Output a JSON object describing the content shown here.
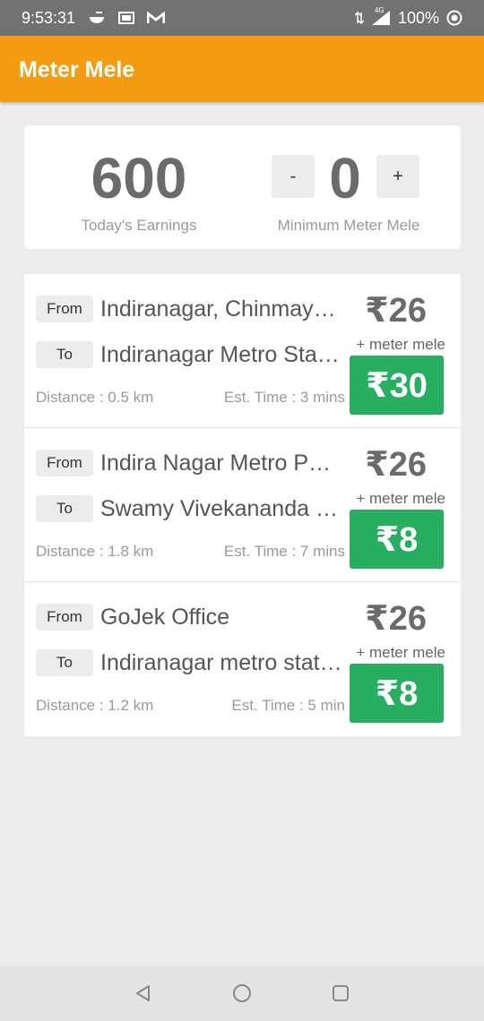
{
  "status": {
    "time": "9:53:31",
    "network": "4G",
    "battery": "100%",
    "icons": [
      "bowl-icon",
      "gsheet-icon",
      "gmail-icon",
      "data-arrows-icon",
      "signal-icon",
      "sync-icon"
    ]
  },
  "app": {
    "title": "Meter Mele",
    "accent": "#f39c12"
  },
  "summary": {
    "earnings_value": "600",
    "earnings_label": "Today's Earnings",
    "decrement_label": "-",
    "increment_label": "+",
    "min_value": "0",
    "min_label": "Minimum Meter Mele"
  },
  "rides": [
    {
      "from_tag": "From",
      "from": "Indiranagar, Chinmaya Mission Hospital",
      "to_tag": "To",
      "to": "Indiranagar Metro Station",
      "distance": "Distance : 0.5 km",
      "time": "Est. Time : 3 mins",
      "fare": "₹26",
      "bonus_label": "+ meter mele",
      "bonus": "₹30"
    },
    {
      "from_tag": "From",
      "from": "Indira Nagar Metro Parking",
      "to_tag": "To",
      "to": "Swamy Vivekananda Road",
      "distance": "Distance : 1.8 km",
      "time": "Est. Time : 7 mins",
      "fare": "₹26",
      "bonus_label": "+ meter mele",
      "bonus": "₹8"
    },
    {
      "from_tag": "From",
      "from": "GoJek Office",
      "to_tag": "To",
      "to": "Indiranagar metro station",
      "distance": "Distance : 1.2 km",
      "time": "Est. Time : 5 min",
      "fare": "₹26",
      "bonus_label": "+ meter mele",
      "bonus": "₹8"
    }
  ],
  "colors": {
    "green": "#27ae60",
    "appbar": "#f39c12",
    "statusbar": "#727272"
  }
}
